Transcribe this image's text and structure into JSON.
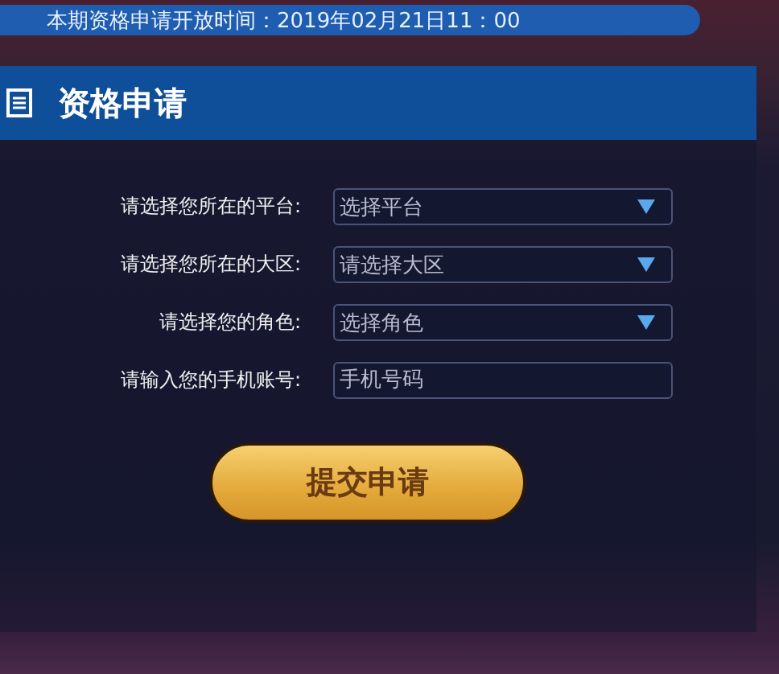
{
  "notice": "本期资格申请开放时间：2019年02月21日11：00",
  "panel": {
    "title": "资格申请"
  },
  "fields": [
    {
      "kind": "select",
      "label": "请选择您所在的平台:",
      "placeholder": "选择平台"
    },
    {
      "kind": "select",
      "label": "请选择您所在的大区:",
      "placeholder": "请选择大区"
    },
    {
      "kind": "select",
      "label": "请选择您的角色:",
      "placeholder": "选择角色"
    },
    {
      "kind": "input",
      "label": "请输入您的手机账号:",
      "placeholder": "手机号码"
    }
  ],
  "submit": "提交申请"
}
